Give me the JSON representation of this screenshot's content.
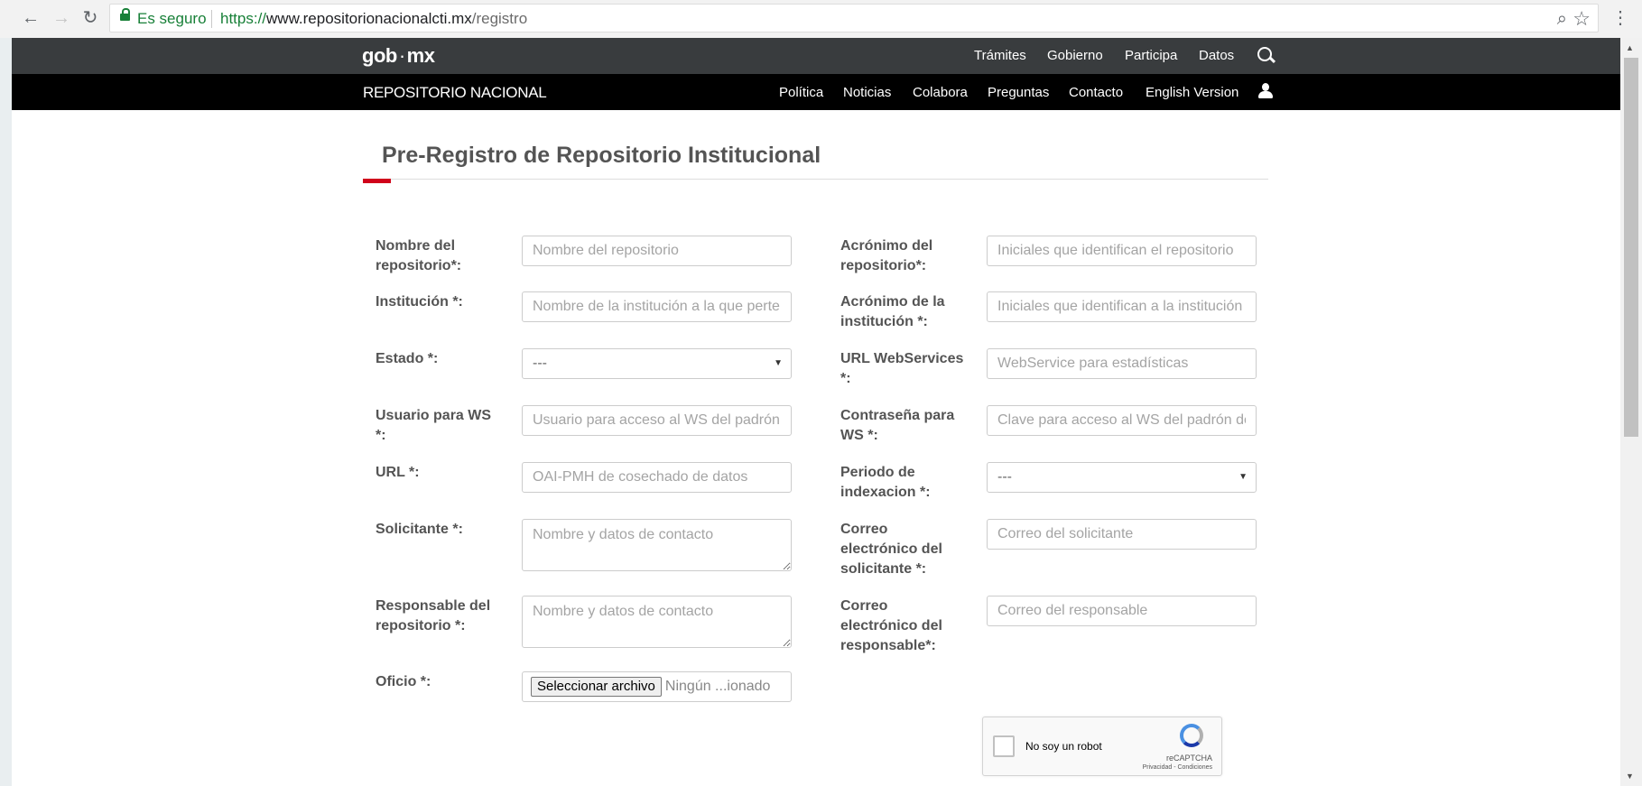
{
  "browser": {
    "secure_label": "Es seguro",
    "url_scheme": "https://",
    "url_host": "www.repositorionacionalcti.mx",
    "url_path": "/registro",
    "icons": [
      "back-icon",
      "forward-icon",
      "reload-icon",
      "lock-icon",
      "zoom-icon",
      "star-icon",
      "menu-icon"
    ]
  },
  "topbar": {
    "brand_a": "gob",
    "brand_b": "mx",
    "links": [
      "Trámites",
      "Gobierno",
      "Participa",
      "Datos"
    ]
  },
  "subbar": {
    "site_title": "REPOSITORIO NACIONAL",
    "links": [
      "Política",
      "Noticias",
      "Colabora",
      "Preguntas",
      "Contacto",
      "English Version"
    ]
  },
  "page": {
    "title": "Pre-Registro de Repositorio Institucional",
    "accent_color": "#d0021b"
  },
  "form": {
    "nombre": {
      "label_1": "Nombre del",
      "label_2": "repositorio*:",
      "placeholder": "Nombre del repositorio"
    },
    "acronimo_repo": {
      "label_1": "Acrónimo del",
      "label_2": "repositorio*:",
      "placeholder": "Iniciales que identifican el repositorio"
    },
    "institucion": {
      "label": "Institución *:",
      "placeholder": "Nombre de la institución a la que pertenece"
    },
    "acronimo_inst": {
      "label_1": "Acrónimo de la",
      "label_2": "institución *:",
      "placeholder": "Iniciales que identifican a la institución"
    },
    "estado": {
      "label": "Estado *:",
      "value": "---"
    },
    "url_ws": {
      "label_1": "URL WebServices",
      "label_2": "*:",
      "placeholder": "WebService para estadísticas"
    },
    "usuario_ws": {
      "label_1": "Usuario para WS",
      "label_2": "*:",
      "placeholder": "Usuario para acceso al WS del padrón de"
    },
    "contrasena_ws": {
      "label_1": "Contraseña para",
      "label_2": "WS *:",
      "placeholder": "Clave para acceso al WS del padrón de"
    },
    "url": {
      "label": "URL *:",
      "placeholder": "OAI-PMH de cosechado de datos"
    },
    "periodo": {
      "label_1": "Periodo de",
      "label_2": "indexacion *:",
      "value": "---"
    },
    "solicitante": {
      "label": "Solicitante *:",
      "placeholder": "Nombre y datos de contacto"
    },
    "correo_solicitante": {
      "label_1": "Correo",
      "label_2": "electrónico del",
      "label_3": "solicitante *:",
      "placeholder": "Correo del solicitante"
    },
    "responsable": {
      "label_1": "Responsable del",
      "label_2": "repositorio *:",
      "placeholder": "Nombre y datos de contacto"
    },
    "correo_responsable": {
      "label_1": "Correo",
      "label_2": "electrónico del",
      "label_3": "responsable*:",
      "placeholder": "Correo del responsable"
    },
    "oficio": {
      "label": "Oficio *:",
      "button": "Seleccionar archivo",
      "file_status": "Ningún ...ionado"
    }
  },
  "recaptcha": {
    "label": "No soy un robot",
    "brand": "reCAPTCHA",
    "terms": "Privacidad - Condiciones"
  }
}
